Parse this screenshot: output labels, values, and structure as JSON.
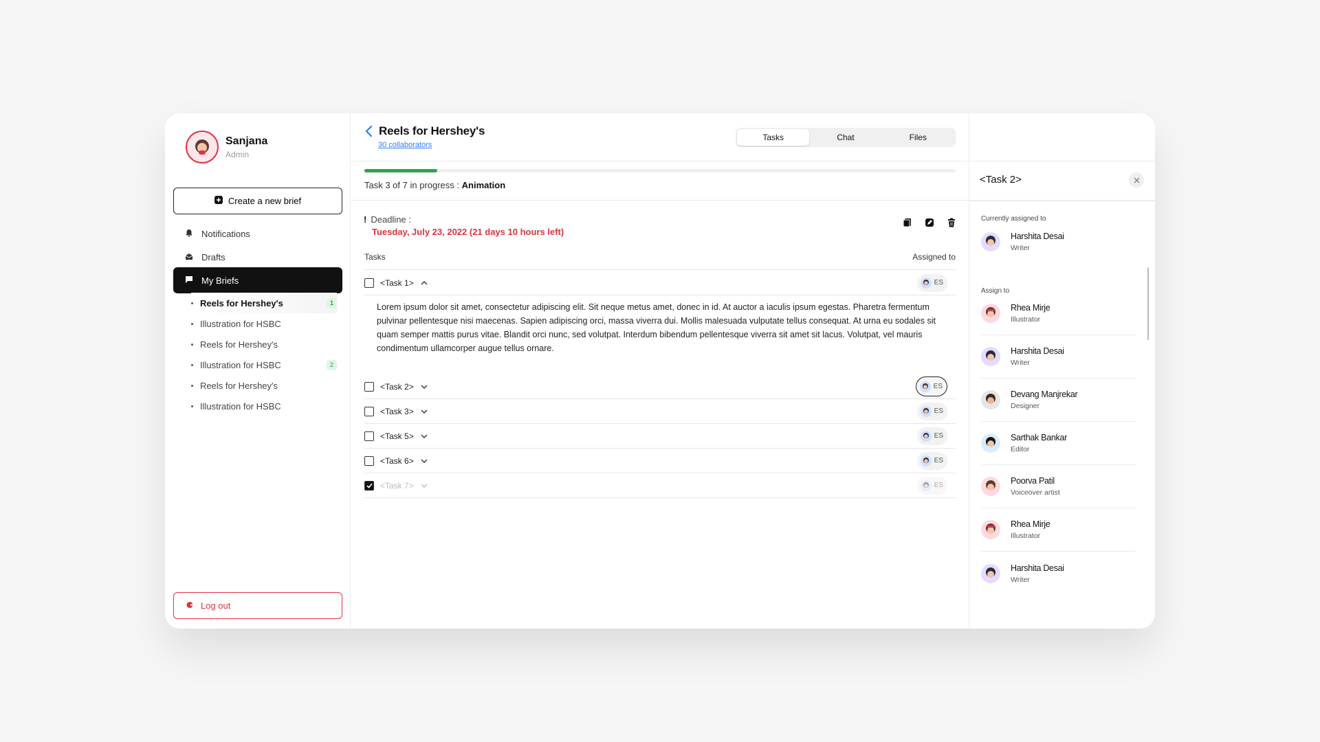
{
  "profile": {
    "name": "Sanjana",
    "role": "Admin"
  },
  "sidebar": {
    "create_label": "Create a new brief",
    "nav": [
      {
        "label": "Notifications",
        "icon": "bell-icon"
      },
      {
        "label": "Drafts",
        "icon": "inbox-icon"
      },
      {
        "label": "My Briefs",
        "icon": "chat-icon"
      }
    ],
    "briefs": [
      {
        "label": "Reels for Hershey's",
        "badge": "1"
      },
      {
        "label": "Illustration for HSBC",
        "badge": ""
      },
      {
        "label": "Reels for Hershey's",
        "badge": ""
      },
      {
        "label": "Illustration for HSBC",
        "badge": "2"
      },
      {
        "label": "Reels for Hershey's",
        "badge": ""
      },
      {
        "label": "Illustration for HSBC",
        "badge": ""
      }
    ],
    "logout_label": "Log out"
  },
  "header": {
    "title": "Reels for Hershey's",
    "collaborators": "30 collaborators",
    "tabs": [
      "Tasks",
      "Chat",
      "Files"
    ],
    "active_tab": "Tasks"
  },
  "progress": {
    "fraction": 0.1233,
    "prefix": "Task 3 of 7 in progress : ",
    "current": "Animation"
  },
  "deadline": {
    "label": "Deadline :",
    "value": "Tuesday, July 23, 2022 (21 days 10 hours left)"
  },
  "tasks": {
    "header_left": "Tasks",
    "header_right": "Assigned to",
    "items": [
      {
        "label": "<Task 1>",
        "assignee": "ES",
        "expanded": true,
        "done": false
      },
      {
        "label": "<Task 2>",
        "assignee": "ES",
        "expanded": false,
        "done": false
      },
      {
        "label": "<Task 3>",
        "assignee": "ES",
        "expanded": false,
        "done": false
      },
      {
        "label": "<Task 5>",
        "assignee": "ES",
        "expanded": false,
        "done": false
      },
      {
        "label": "<Task 6>",
        "assignee": "ES",
        "expanded": false,
        "done": false
      },
      {
        "label": "<Task 7>",
        "assignee": "ES",
        "expanded": false,
        "done": true
      }
    ],
    "description": "Lorem ipsum dolor sit amet, consectetur adipiscing elit. Sit neque metus amet, donec in id. At auctor a iaculis ipsum egestas. Pharetra fermentum pulvinar pellentesque nisi maecenas. Sapien adipiscing orci, massa viverra dui. Mollis malesuada vulputate tellus consequat. At urna eu sodales sit quam semper mattis purus vitae. Blandit orci nunc, sed volutpat. Interdum bibendum pellentesque viverra sit amet sit lacus. Volutpat, vel mauris condimentum ullamcorper augue tellus ornare."
  },
  "panel": {
    "title": "<Task 2>",
    "current_label": "Currently assigned to",
    "current": {
      "name": "Harshita Desai",
      "role": "Writer"
    },
    "assign_label": "Assign to",
    "people": [
      {
        "name": "Rhea Mirje",
        "role": "Illustrator"
      },
      {
        "name": "Harshita Desai",
        "role": "Writer"
      },
      {
        "name": "Devang Manjrekar",
        "role": "Designer"
      },
      {
        "name": "Sarthak Bankar",
        "role": "Editor"
      },
      {
        "name": "Poorva Patil",
        "role": "Voiceover artist"
      },
      {
        "name": "Rhea Mirje",
        "role": "Illustrator"
      },
      {
        "name": "Harshita Desai",
        "role": "Writer"
      }
    ]
  },
  "colors": {
    "accent": "#2f7cf6",
    "danger": "#e0323e",
    "success": "#2ea44f"
  }
}
